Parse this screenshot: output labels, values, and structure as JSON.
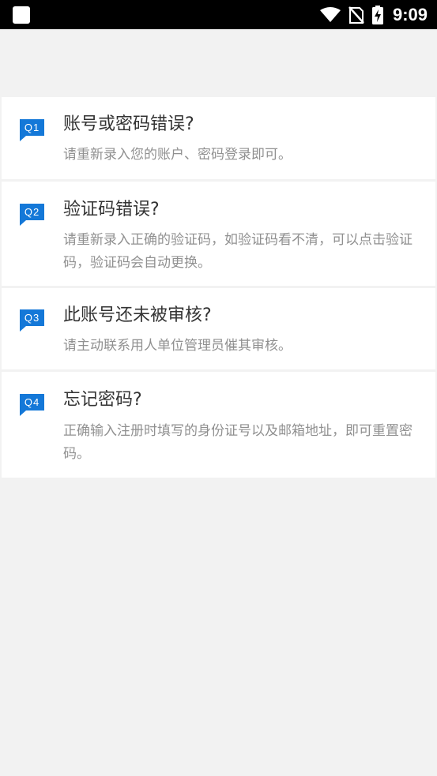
{
  "status_bar": {
    "time": "9:09",
    "icons": [
      "app-icon",
      "wifi-icon",
      "no-sim-icon",
      "battery-charging-icon"
    ]
  },
  "colors": {
    "accent": "#1478d8",
    "background": "#f2f2f2",
    "card": "#ffffff",
    "question_text": "#333333",
    "answer_text": "#909090"
  },
  "faq": [
    {
      "badge": "Q1",
      "question": "账号或密码错误?",
      "answer": "请重新录入您的账户、密码登录即可。"
    },
    {
      "badge": "Q2",
      "question": "验证码错误?",
      "answer": "请重新录入正确的验证码，如验证码看不清，可以点击验证码，验证码会自动更换。"
    },
    {
      "badge": "Q3",
      "question": "此账号还未被审核?",
      "answer": "请主动联系用人单位管理员催其审核。"
    },
    {
      "badge": "Q4",
      "question": "忘记密码?",
      "answer": "正确输入注册时填写的身份证号以及邮箱地址，即可重置密码。"
    }
  ]
}
